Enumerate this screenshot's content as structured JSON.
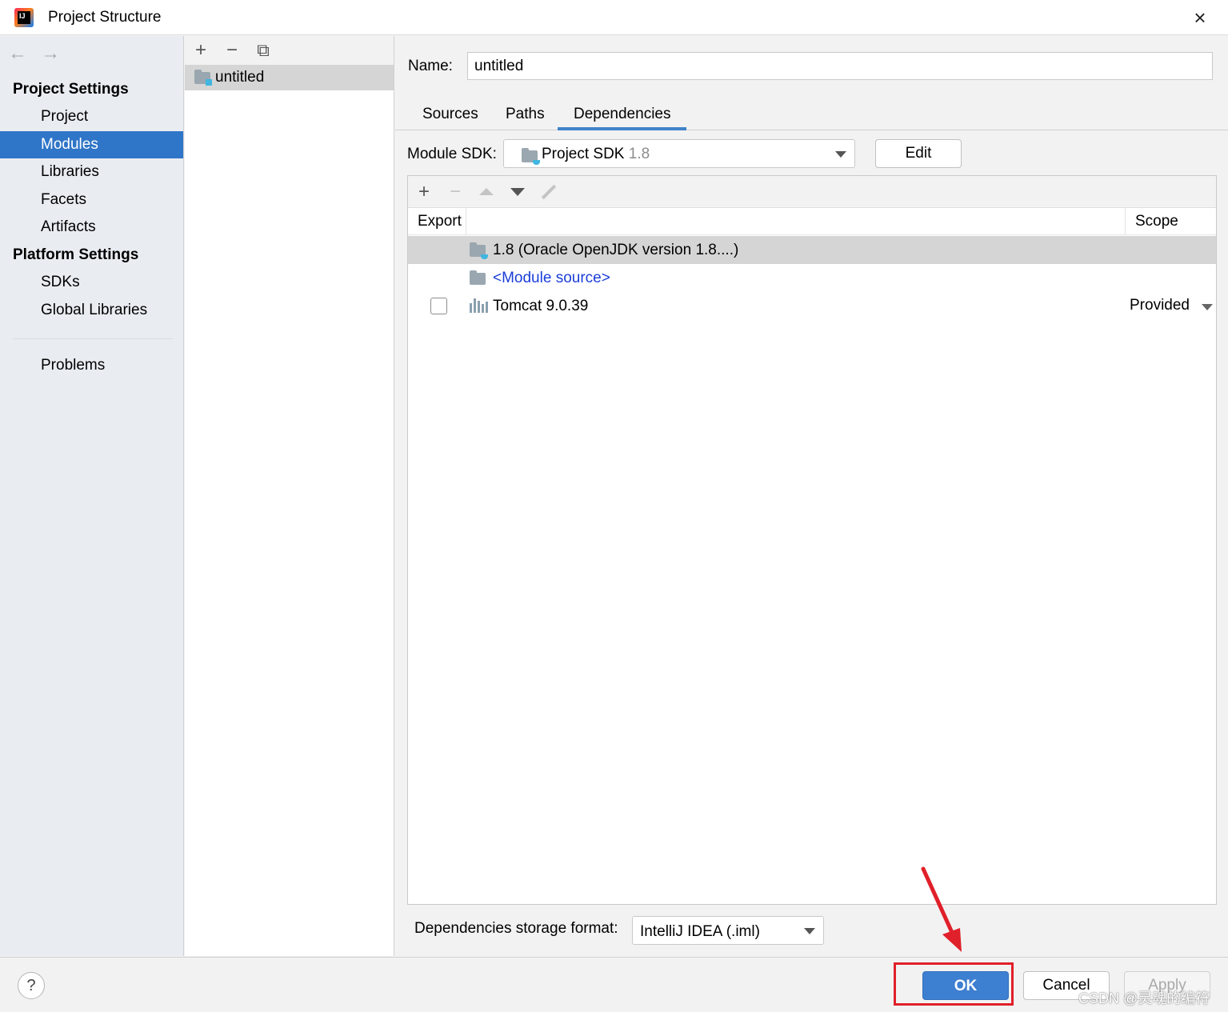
{
  "window": {
    "title": "Project Structure",
    "close_glyph": "×",
    "app_icon": "intellij-idea-icon",
    "app_icon_text": "IJ"
  },
  "nav": {
    "back_glyph": "←",
    "forward_glyph": "→"
  },
  "sidebar": {
    "project_settings_header": "Project Settings",
    "project_items": [
      {
        "label": "Project",
        "selected": false
      },
      {
        "label": "Modules",
        "selected": true
      },
      {
        "label": "Libraries",
        "selected": false
      },
      {
        "label": "Facets",
        "selected": false
      },
      {
        "label": "Artifacts",
        "selected": false
      }
    ],
    "platform_settings_header": "Platform Settings",
    "platform_items": [
      {
        "label": "SDKs"
      },
      {
        "label": "Global Libraries"
      }
    ],
    "problems_label": "Problems"
  },
  "module_list": {
    "toolbar": {
      "add_glyph": "+",
      "remove_glyph": "−",
      "copy_glyph": "⧉"
    },
    "modules": [
      {
        "name": "untitled"
      }
    ]
  },
  "module": {
    "name_label": "Name:",
    "name_value": "untitled",
    "tabs": [
      {
        "label": "Sources",
        "active": false
      },
      {
        "label": "Paths",
        "active": false
      },
      {
        "label": "Dependencies",
        "active": true
      }
    ],
    "sdk_label": "Module SDK:",
    "sdk_name": "Project SDK",
    "sdk_version": "1.8",
    "edit_label": "Edit"
  },
  "dependencies": {
    "toolbar": {
      "add_glyph": "+",
      "remove_glyph": "−"
    },
    "columns": {
      "export": "Export",
      "scope": "Scope"
    },
    "rows": [
      {
        "label": "1.8 (Oracle OpenJDK version 1.8....)",
        "type": "sdk",
        "selected": true
      },
      {
        "label": "<Module source>",
        "type": "source",
        "selected": false
      },
      {
        "label": "Tomcat 9.0.39",
        "type": "library",
        "selected": false,
        "export_checked": false,
        "scope": "Provided"
      }
    ],
    "storage_label": "Dependencies storage format:",
    "storage_value": "IntelliJ IDEA (.iml)"
  },
  "footer": {
    "help_glyph": "?",
    "ok_label": "OK",
    "cancel_label": "Cancel",
    "apply_label": "Apply",
    "watermark": "CSDN @灵魂的编符"
  },
  "colors": {
    "selection": "#2f75c8",
    "ok_button": "#3d7fd1",
    "annotation": "#e0202a",
    "link": "#1a3ed9"
  }
}
